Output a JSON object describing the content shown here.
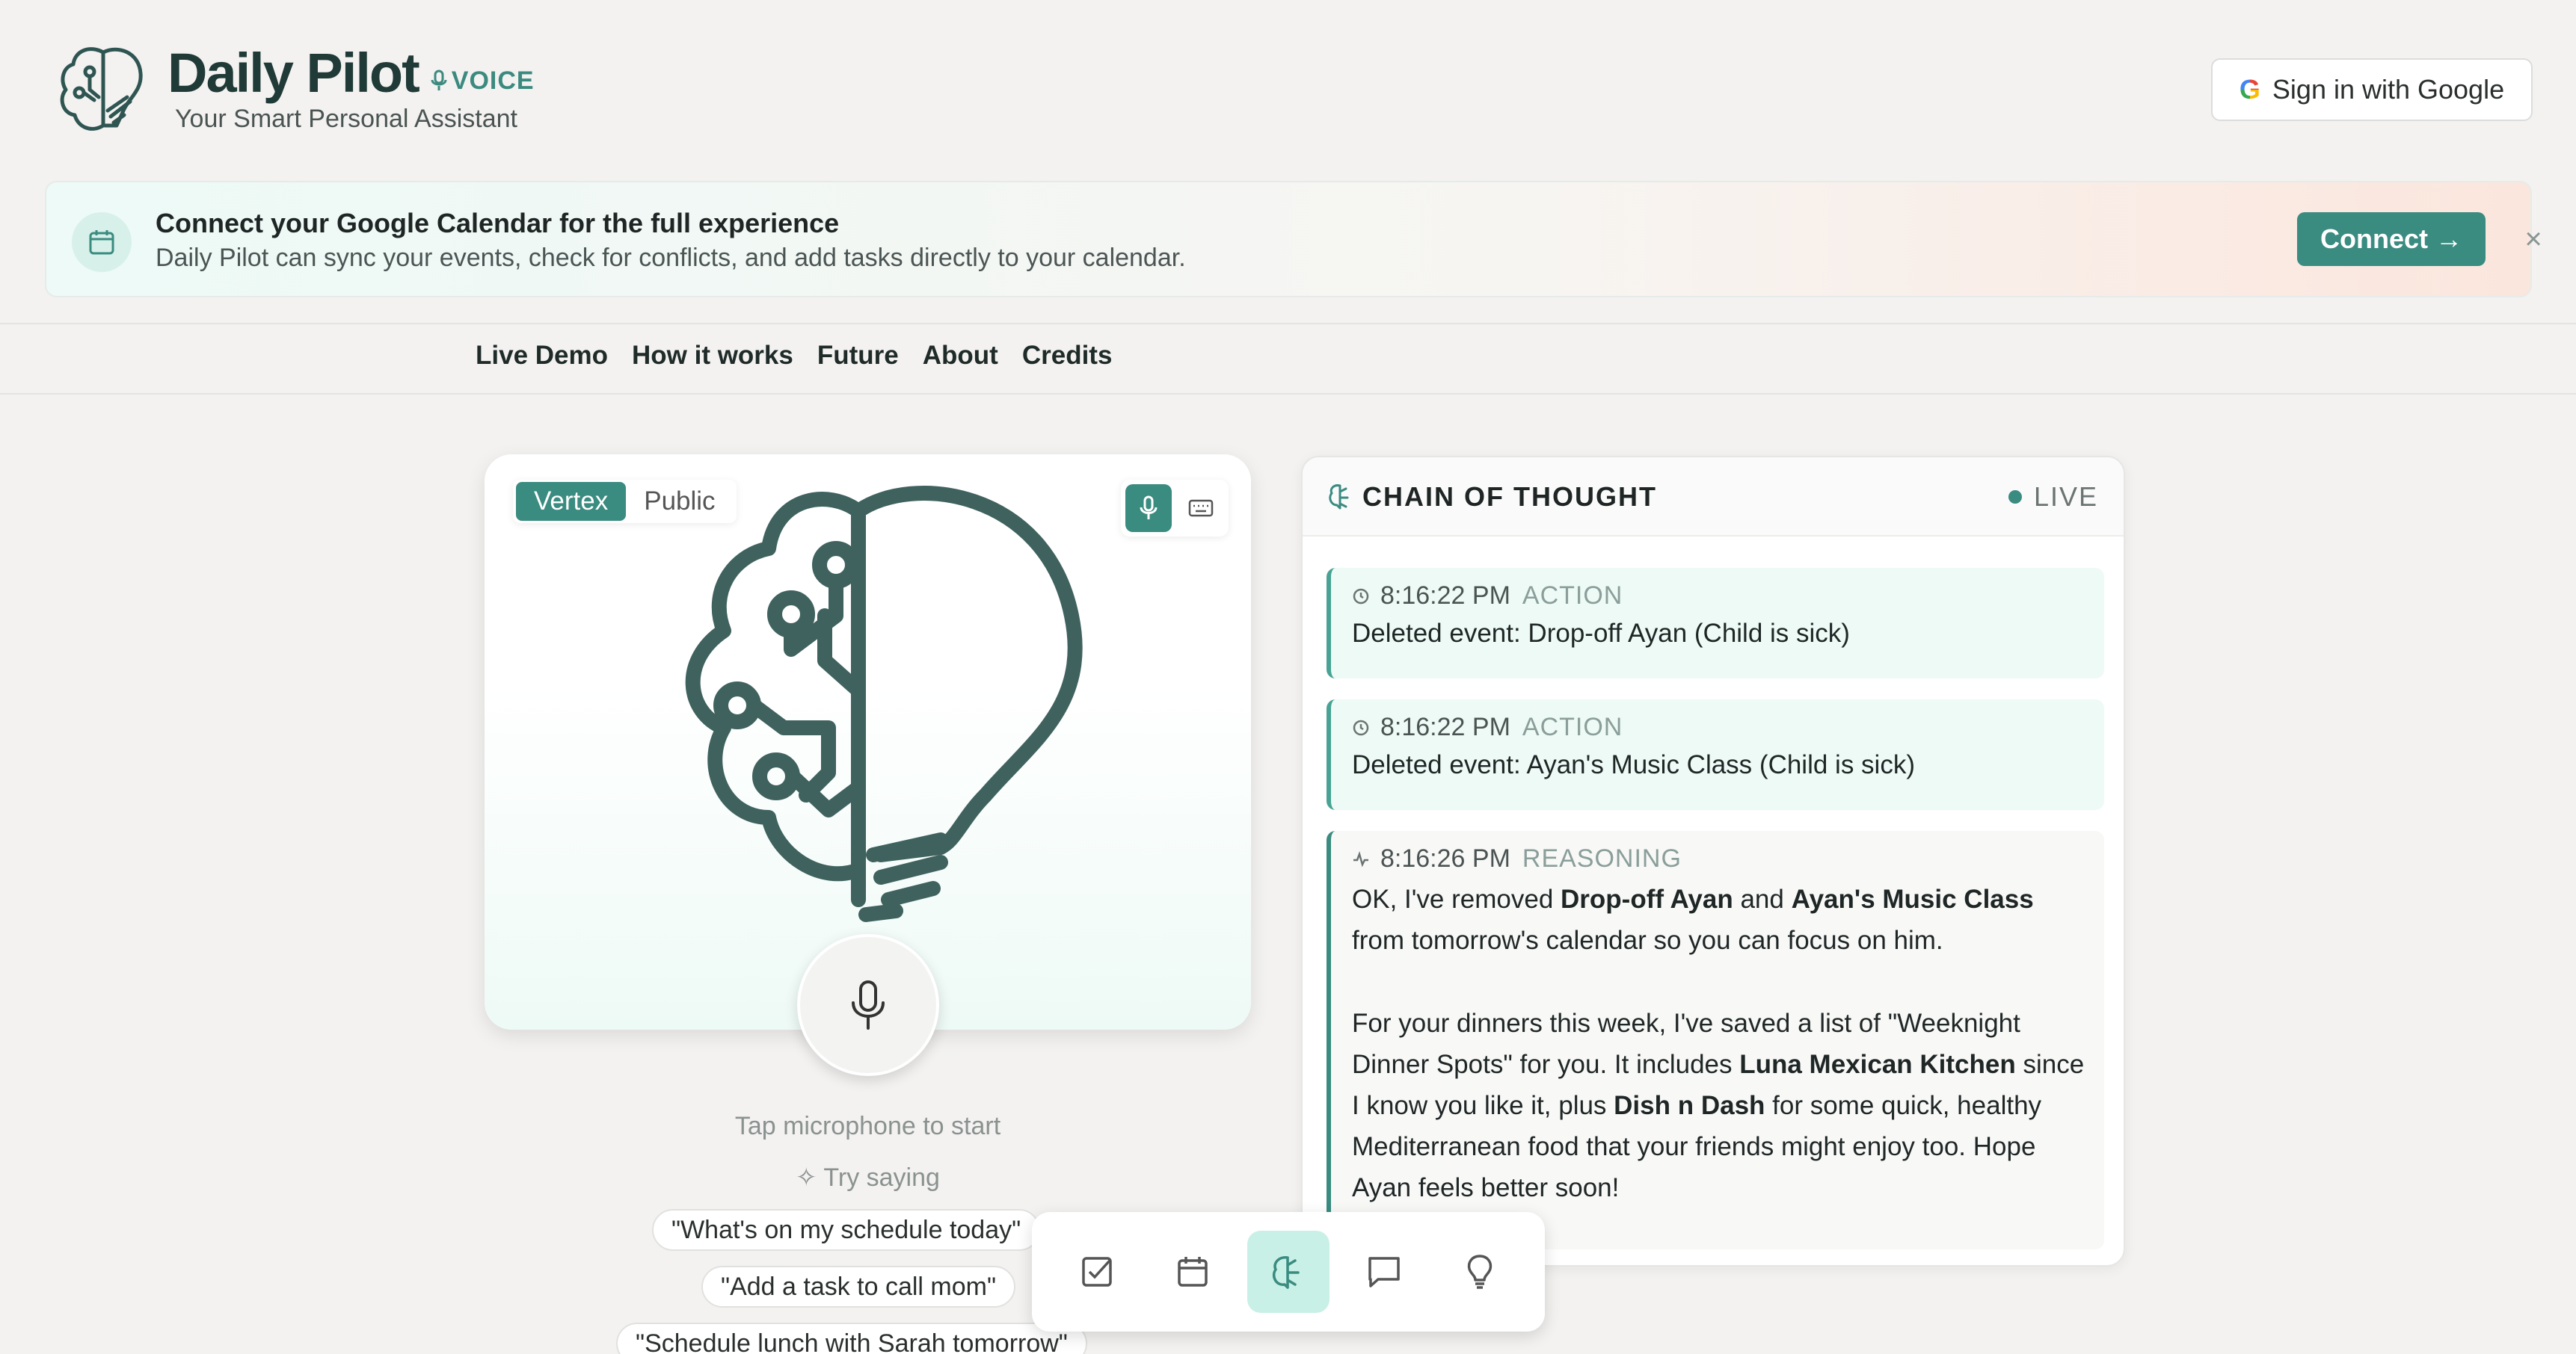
{
  "brand": {
    "title": "Daily Pilot",
    "badge": "VOICE",
    "subtitle": "Your Smart Personal Assistant",
    "logo_icon": "brain-bulb-icon"
  },
  "auth": {
    "signin_label": "Sign in with Google",
    "g_letter": "G"
  },
  "banner": {
    "title": "Connect your Google Calendar for the full experience",
    "text": "Daily Pilot can sync your events, check for conflicts, and add tasks directly to your calendar.",
    "connect_label": "Connect →",
    "close_glyph": "×"
  },
  "nav": {
    "items": [
      {
        "label": "Live Demo"
      },
      {
        "label": "How it works"
      },
      {
        "label": "Future"
      },
      {
        "label": "About"
      },
      {
        "label": "Credits"
      }
    ]
  },
  "voice": {
    "models": [
      {
        "label": "Vertex",
        "active": true
      },
      {
        "label": "Public",
        "active": false
      }
    ],
    "tap_hint": "Tap microphone to start",
    "try_label": "✧ Try saying",
    "suggestions": [
      "\"What's on my schedule today\"",
      "\"Add a task to call mom\"",
      "\"Schedule lunch with Sarah tomorrow\""
    ]
  },
  "cot": {
    "title": "CHAIN OF THOUGHT",
    "live_label": "LIVE",
    "entries": [
      {
        "time": "8:16:22 PM",
        "kind": "ACTION",
        "text": "Deleted event: Drop-off Ayan (Child is sick)"
      },
      {
        "time": "8:16:22 PM",
        "kind": "ACTION",
        "text": "Deleted event: Ayan's Music Class (Child is sick)"
      },
      {
        "time": "8:16:26 PM",
        "kind": "REASONING",
        "p1_a": "OK, I've removed ",
        "p1_b": "Drop-off Ayan",
        "p1_c": " and ",
        "p1_d": "Ayan's Music Class",
        "p1_e": "from tomorrow's calendar so you can focus on him.",
        "p2_a": "For your dinners this week, I've saved a list of \"Weeknight Dinner Spots\" for you. It includes ",
        "p2_b": "Luna Mexican Kitchen",
        "p2_c": " since I know you like it, plus ",
        "p2_d": "Dish n Dash",
        "p2_e": " for some quick, healthy Mediterranean food that your friends might enjoy too. Hope Ayan feels better soon!"
      }
    ]
  },
  "dock": {
    "items": [
      {
        "icon": "checkbox-icon"
      },
      {
        "icon": "calendar-icon"
      },
      {
        "icon": "brain-icon",
        "active": true
      },
      {
        "icon": "chat-bubble-icon"
      },
      {
        "icon": "lightbulb-icon"
      }
    ]
  },
  "colors": {
    "accent": "#3a8b80",
    "brand_dark": "#1f3a37",
    "active_tint": "#c9f0e6"
  }
}
